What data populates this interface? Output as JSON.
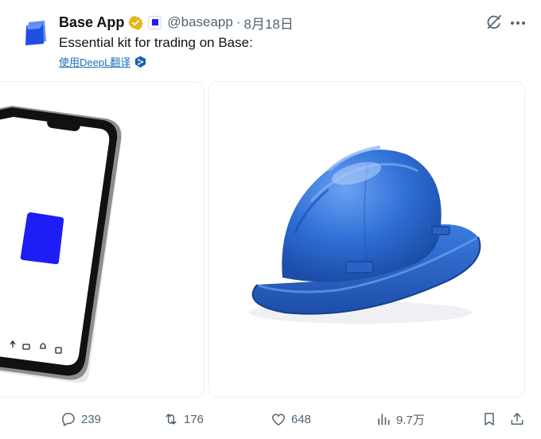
{
  "tweet": {
    "display_name": "Base App",
    "handle": "@baseapp",
    "separator": "·",
    "date": "8月18日",
    "text": "Essential kit for trading on Base:",
    "translate_label": "使用DeepL翻译"
  },
  "actions": {
    "replies": "239",
    "reposts": "176",
    "likes": "648",
    "views": "9.7万"
  },
  "colors": {
    "brand_blue": "#1d1df5",
    "hat_blue": "#2f6fd6",
    "verified_gold": "#e2b719",
    "link_blue": "#1d6fb8"
  },
  "icons": [
    "verified-badge-icon",
    "grok-icon",
    "more-icon",
    "deepl-icon",
    "reply-icon",
    "repost-icon",
    "like-icon",
    "views-icon",
    "bookmark-icon",
    "share-icon"
  ]
}
